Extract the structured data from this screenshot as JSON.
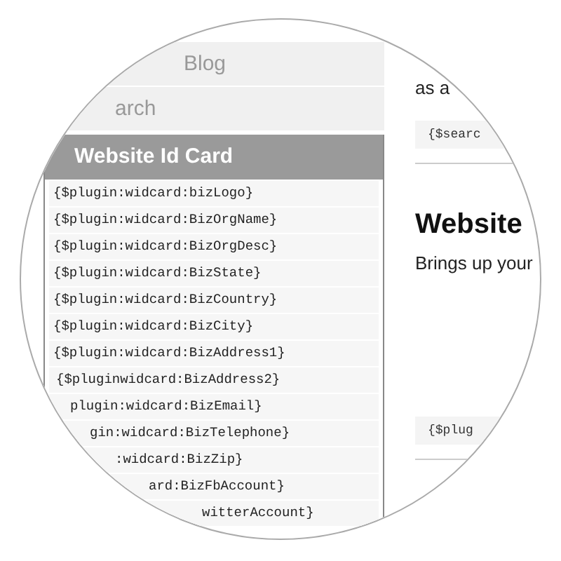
{
  "sidebar": {
    "nav_items": [
      "Blog",
      "arch"
    ],
    "panel_title": "Website Id Card",
    "tags": [
      "{$plugin:widcard:bizLogo}",
      "{$plugin:widcard:BizOrgName}",
      "{$plugin:widcard:BizOrgDesc}",
      "{$plugin:widcard:BizState}",
      "{$plugin:widcard:BizCountry}",
      "{$plugin:widcard:BizCity}",
      "{$plugin:widcard:BizAddress1}",
      "{$pluginwidcard:BizAddress2}",
      "plugin:widcard:BizEmail}",
      "gin:widcard:BizTelephone}",
      ":widcard:BizZip}",
      "ard:BizFbAccount}",
      "witterAccount}"
    ]
  },
  "content": {
    "intro_text": "as a",
    "code_top": "{$searc",
    "heading": "Website",
    "description": "Brings up your",
    "code_bottom": "{$plug"
  }
}
